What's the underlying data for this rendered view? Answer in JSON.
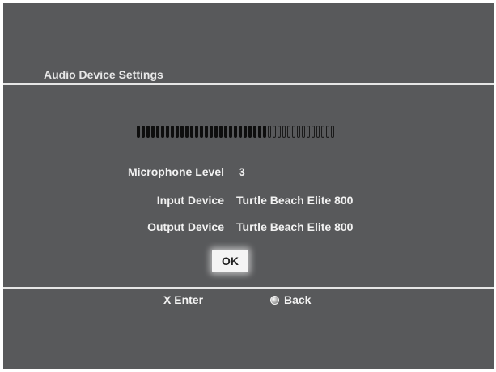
{
  "screen": {
    "title": "Audio Device Settings"
  },
  "meter": {
    "total_segments": 41,
    "filled_segments": 27
  },
  "settings": {
    "microphone_level_label": "Microphone Level",
    "microphone_level_value": "3",
    "input_device_label": "Input Device",
    "input_device_value": "Turtle Beach Elite 800",
    "output_device_label": "Output Device",
    "output_device_value": "Turtle Beach Elite 800"
  },
  "buttons": {
    "ok_label": "OK"
  },
  "hints": {
    "enter_label": "X Enter",
    "back_label": "Back",
    "back_icon": "circle-icon"
  },
  "colors": {
    "background": "#58595b",
    "text": "#f2f2f2",
    "divider": "#e6e6e6",
    "button_bg": "#f4f4f4"
  }
}
